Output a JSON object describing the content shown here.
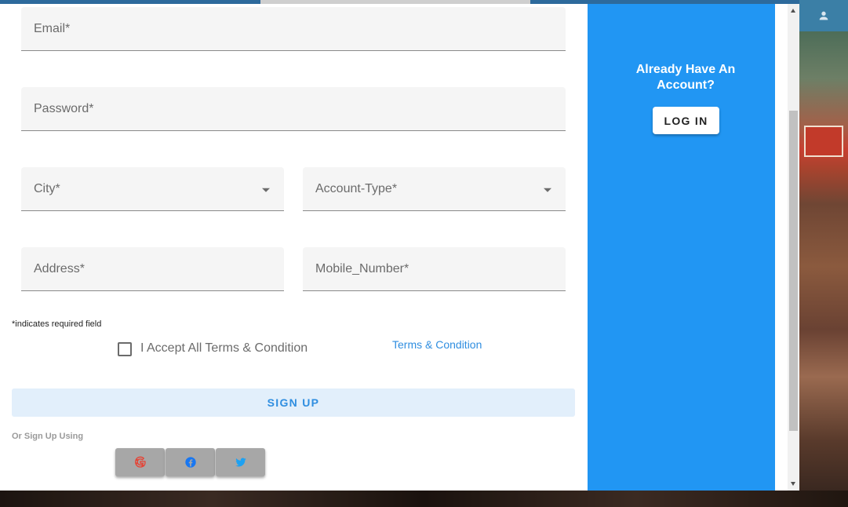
{
  "form": {
    "email_label": "Email*",
    "password_label": "Password*",
    "city_label": "City*",
    "account_type_label": "Account-Type*",
    "address_label": "Address*",
    "mobile_label": "Mobile_Number*",
    "required_note": "*indicates required field",
    "accept_label": "I Accept All Terms & Condition",
    "terms_link": "Terms & Condition",
    "signup_label": "SIGN UP",
    "or_sign_up_using": "Or Sign Up Using"
  },
  "social": [
    {
      "icon": "google-icon",
      "color": "#e54335"
    },
    {
      "icon": "facebook-icon",
      "color": "#1877f2"
    },
    {
      "icon": "twitter-icon",
      "color": "#1da1f2"
    }
  ],
  "side_panel": {
    "heading_line1": "Already Have An",
    "heading_line2": "Account?",
    "login_label": "LOG IN",
    "color": "#2196f3"
  },
  "colors": {
    "accent": "#2f8ee0",
    "signup_bg": "#e2effb"
  }
}
